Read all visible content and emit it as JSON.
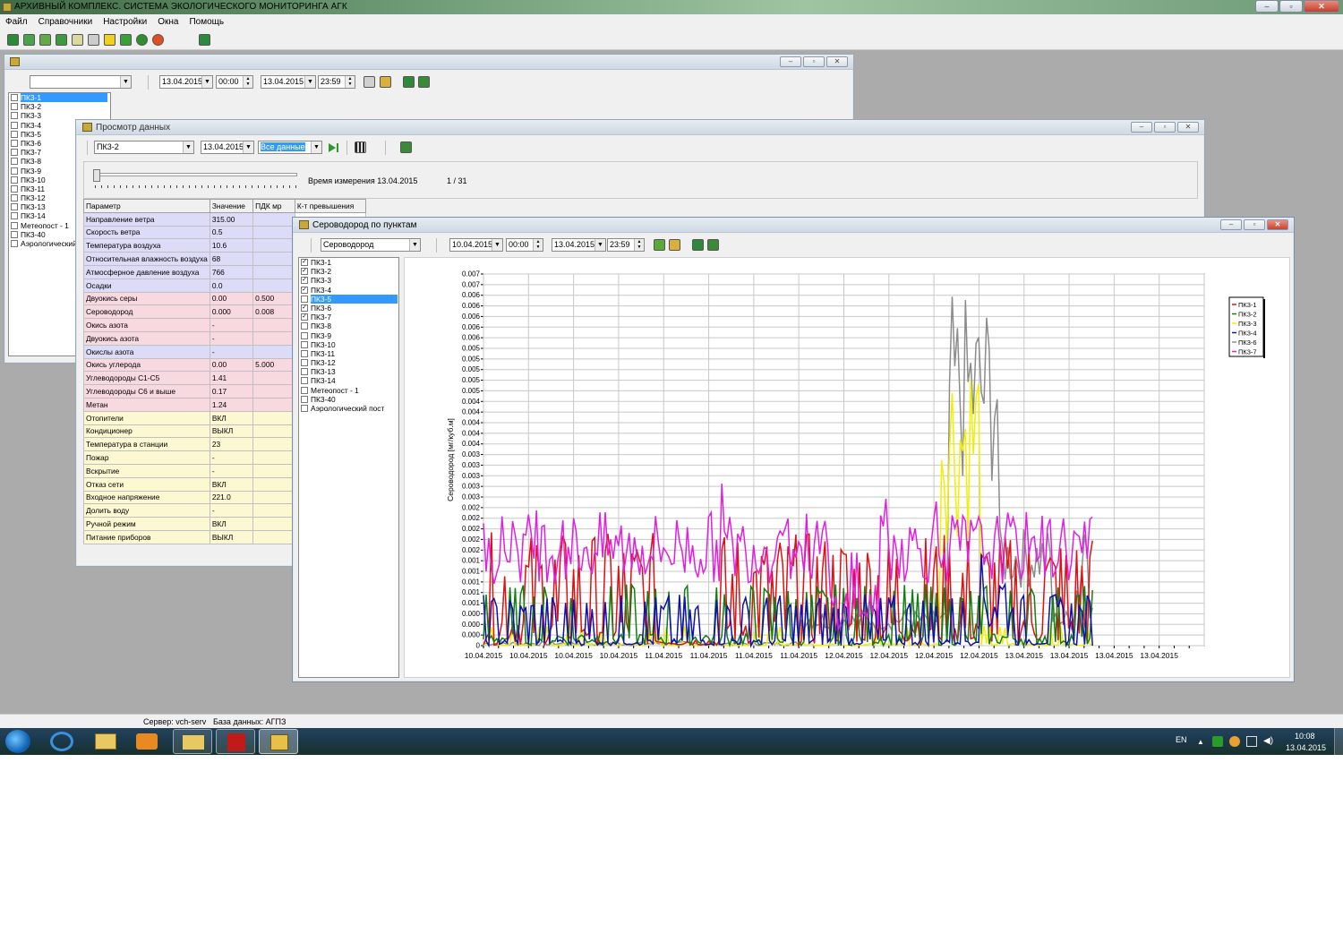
{
  "app": {
    "title": "АРХИВНЫЙ КОМПЛЕКС. СИСТЕМА ЭКОЛОГИЧЕСКОГО МОНИТОРИНГА АГК"
  },
  "menu": [
    "Файл",
    "Справочники",
    "Настройки",
    "Окна",
    "Помощь"
  ],
  "back_window": {
    "date_from": "13.04.2015",
    "time_from": "00:00",
    "date_to": "13.04.2015",
    "time_to": "23:59",
    "points": [
      "ПК3-1",
      "ПК3-2",
      "ПК3-3",
      "ПК3-4",
      "ПК3-5",
      "ПК3-6",
      "ПК3-7",
      "ПК3-8",
      "ПК3-9",
      "ПК3-10",
      "ПК3-11",
      "ПК3-12",
      "ПК3-13",
      "ПК3-14",
      "Метеопост - 1",
      "ПК3-40",
      "Аэрологический пост"
    ]
  },
  "data_view": {
    "title": "Просмотр данных",
    "point": "ПК3-2",
    "date": "13.04.2015",
    "mode": "Все данные",
    "measure_time": "Время измерения 13.04.2015",
    "page_counter": "1 / 31",
    "columns": [
      "Параметр",
      "Значение",
      "ПДК мр",
      "К-т превышения"
    ],
    "rows": [
      {
        "param": "Направление ветра",
        "value": "315.00",
        "pdk": "",
        "group": "lav"
      },
      {
        "param": "Скорость ветра",
        "value": "0.5",
        "pdk": "",
        "group": "lav"
      },
      {
        "param": "Температура воздуха",
        "value": "10.6",
        "pdk": "",
        "group": "lav"
      },
      {
        "param": "Относительная влажность воздуха",
        "value": "68",
        "pdk": "",
        "group": "lav"
      },
      {
        "param": "Атмосферное давление воздуха",
        "value": "766",
        "pdk": "",
        "group": "lav"
      },
      {
        "param": "Осадки",
        "value": "0.0",
        "pdk": "",
        "group": "lav"
      },
      {
        "param": "Двуокись серы",
        "value": "0.00",
        "pdk": "0.500",
        "group": "pink"
      },
      {
        "param": "Сероводород",
        "value": "0.000",
        "pdk": "0.008",
        "group": "pink"
      },
      {
        "param": "Окись азота",
        "value": "-",
        "pdk": "",
        "group": "pink"
      },
      {
        "param": "Двуокись азота",
        "value": "-",
        "pdk": "",
        "group": "pink"
      },
      {
        "param": "Окислы азота",
        "value": "-",
        "pdk": "",
        "group": "lav"
      },
      {
        "param": "Окись углерода",
        "value": "0.00",
        "pdk": "5.000",
        "group": "pink"
      },
      {
        "param": "Углеводороды С1-С5",
        "value": "1.41",
        "pdk": "",
        "group": "pink"
      },
      {
        "param": "Углеводороды С6 и выше",
        "value": "0.17",
        "pdk": "",
        "group": "pink"
      },
      {
        "param": "Метан",
        "value": "1.24",
        "pdk": "",
        "group": "pink"
      },
      {
        "param": "Отопители",
        "value": "ВКЛ",
        "pdk": "",
        "group": "yel"
      },
      {
        "param": "Кондиционер",
        "value": "ВЫКЛ",
        "pdk": "",
        "group": "yel"
      },
      {
        "param": "Температура в станции",
        "value": "23",
        "pdk": "",
        "group": "yel"
      },
      {
        "param": "Пожар",
        "value": "-",
        "pdk": "",
        "group": "yel"
      },
      {
        "param": "Вскрытие",
        "value": "-",
        "pdk": "",
        "group": "yel"
      },
      {
        "param": "Отказ сети",
        "value": "ВКЛ",
        "pdk": "",
        "group": "yel"
      },
      {
        "param": "Входное напряжение",
        "value": "221.0",
        "pdk": "",
        "group": "yel"
      },
      {
        "param": "Долить воду",
        "value": "-",
        "pdk": "",
        "group": "yel"
      },
      {
        "param": "Ручной режим",
        "value": "ВКЛ",
        "pdk": "",
        "group": "yel"
      },
      {
        "param": "Питание приборов",
        "value": "ВЫКЛ",
        "pdk": "",
        "group": "yel"
      }
    ]
  },
  "chart_window": {
    "title": "Сероводород по пунктам",
    "substance": "Сероводород",
    "date_from": "10.04.2015",
    "time_from": "00:00",
    "date_to": "13.04.2015",
    "time_to": "23:59",
    "points": [
      {
        "label": "ПК3-1",
        "checked": true
      },
      {
        "label": "ПК3-2",
        "checked": true
      },
      {
        "label": "ПК3-3",
        "checked": true
      },
      {
        "label": "ПК3-4",
        "checked": true
      },
      {
        "label": "ПК3-5",
        "checked": false,
        "selected": true
      },
      {
        "label": "ПК3-6",
        "checked": true
      },
      {
        "label": "ПК3-7",
        "checked": true
      },
      {
        "label": "ПК3-8",
        "checked": false
      },
      {
        "label": "ПК3-9",
        "checked": false
      },
      {
        "label": "ПК3-10",
        "checked": false
      },
      {
        "label": "ПК3-11",
        "checked": false
      },
      {
        "label": "ПК3-12",
        "checked": false
      },
      {
        "label": "ПК3-13",
        "checked": false
      },
      {
        "label": "ПК3-14",
        "checked": false
      },
      {
        "label": "Метеопост - 1",
        "checked": false
      },
      {
        "label": "ПК3-40",
        "checked": false
      },
      {
        "label": "Аэрологический пост",
        "checked": false
      }
    ]
  },
  "chart_data": {
    "type": "line",
    "title": "",
    "xlabel": "",
    "ylabel": "Сероводород [мг/куб.м]",
    "y_ticks": [
      "0",
      "0.000",
      "0.000",
      "0.000",
      "0.001",
      "0.001",
      "0.001",
      "0.001",
      "0.001",
      "0.002",
      "0.002",
      "0.002",
      "0.002",
      "0.002",
      "0.003",
      "0.003",
      "0.003",
      "0.003",
      "0.003",
      "0.004",
      "0.004",
      "0.004",
      "0.004",
      "0.004",
      "0.005",
      "0.005",
      "0.005",
      "0.005",
      "0.005",
      "0.006",
      "0.006",
      "0.006",
      "0.006",
      "0.006",
      "0.007",
      "0.007"
    ],
    "x_ticks": [
      "10.04.2015",
      "10.04.2015",
      "10.04.2015",
      "10.04.2015",
      "11.04.2015",
      "11.04.2015",
      "11.04.2015",
      "11.04.2015",
      "12.04.2015",
      "12.04.2015",
      "12.04.2015",
      "12.04.2015",
      "13.04.2015",
      "13.04.2015",
      "13.04.2015",
      "13.04.2015"
    ],
    "ylim": [
      0,
      0.0072
    ],
    "xlim": [
      0,
      96
    ],
    "grid": true,
    "legend_position": "right",
    "series": [
      {
        "name": "ПК3-1",
        "color": "#e01010"
      },
      {
        "name": "ПК3-2",
        "color": "#108010"
      },
      {
        "name": "ПК3-3",
        "color": "#f0f000"
      },
      {
        "name": "ПК3-4",
        "color": "#1010b0"
      },
      {
        "name": "ПК3-6",
        "color": "#8c8c8c"
      },
      {
        "name": "ПК3-7",
        "color": "#e020e0"
      }
    ]
  },
  "status": {
    "server": "Сервер: vch-serv",
    "db": "База данных: АГПЗ"
  },
  "tray": {
    "lang": "EN",
    "time": "10:08",
    "date": "13.04.2015"
  }
}
